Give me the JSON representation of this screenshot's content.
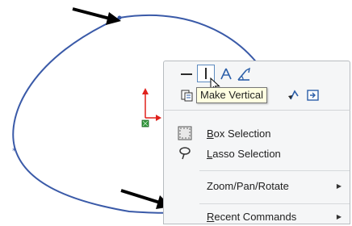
{
  "tooltip": {
    "text": "Make Vertical"
  },
  "toolbar": {
    "icons": [
      "make-horizontal-icon",
      "make-vertical-icon",
      "fix-icon",
      "smart-dimension-icon",
      "copy-entities-icon",
      "reverse-icon",
      "exit-sketch-icon"
    ]
  },
  "menu": {
    "items": [
      {
        "key": "box",
        "label_u": "B",
        "label_rest": "ox Selection",
        "icon": "box-selection-icon"
      },
      {
        "key": "lasso",
        "label_u": "L",
        "label_rest": "asso Selection",
        "icon": "lasso-selection-icon"
      },
      {
        "key": "zoom",
        "label": "Zoom/Pan/Rotate",
        "submenu": true
      },
      {
        "key": "recent",
        "label_u": "R",
        "label_rest": "ecent Commands",
        "submenu": true
      }
    ]
  },
  "colors": {
    "ellipse": "#3a5aa8",
    "axis_red": "#e0201b",
    "axis_green": "#2f9a3a",
    "toolbar_bg": "#f5f6f7",
    "tooltip_bg": "#ffffe1"
  }
}
